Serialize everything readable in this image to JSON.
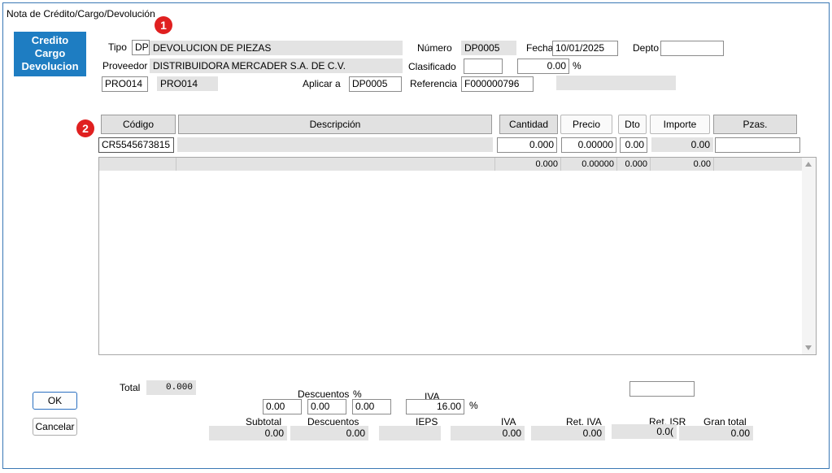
{
  "window": {
    "title": "Nota de Crédito/Cargo/Devolución"
  },
  "brand": {
    "line1": "Credito",
    "line2": "Cargo",
    "line3": "Devolucion"
  },
  "badges": {
    "one": "1",
    "two": "2"
  },
  "header": {
    "tipo_label": "Tipo",
    "tipo_code": "DP",
    "tipo_desc": "DEVOLUCION DE PIEZAS",
    "numero_label": "Número",
    "numero_value": "DP0005",
    "fecha_label": "Fecha",
    "fecha_value": "10/01/2025",
    "depto_label": "Depto",
    "depto_value": "",
    "proveedor_label": "Proveedor",
    "proveedor_value": "DISTRIBUIDORA MERCADER S.A. DE C.V.",
    "clasificado_label": "Clasificado",
    "clasificado_value": "",
    "pct_value": "0.00",
    "pct_symbol": "%",
    "prov_code_input": "PRO014",
    "prov_code_display": "PRO014",
    "aplicar_label": "Aplicar a",
    "aplicar_value": "DP0005",
    "referencia_label": "Referencia",
    "referencia_value": "F000000796",
    "extra_value": ""
  },
  "columns": {
    "codigo": "Código",
    "descripcion": "Descripción",
    "cantidad": "Cantidad",
    "precio": "Precio",
    "dto": "Dto",
    "importe": "Importe",
    "pzas": "Pzas."
  },
  "entry": {
    "codigo": "CR5545673815",
    "descripcion": "",
    "cantidad": "0.000",
    "precio": "0.00000",
    "dto": "0.00",
    "importe": "0.00",
    "pzas": ""
  },
  "grid_row": {
    "cantidad": "0.000",
    "precio": "0.00000",
    "dto": "0.000",
    "importe": "0.00"
  },
  "footer": {
    "total_label": "Total",
    "total_value": "0.000",
    "descuentos_label": "Descuentos",
    "descuentos_pct": "%",
    "desc1": "0.00",
    "desc2": "0.00",
    "desc3": "0.00",
    "iva_label": "IVA",
    "iva_value": "16.00",
    "iva_pct": "%",
    "right_box": "",
    "ok": "OK",
    "cancelar": "Cancelar",
    "subtotal_label": "Subtotal",
    "subtotal_value": "0.00",
    "descuentos2_label": "Descuentos",
    "descuentos2_value": "0.00",
    "ieps_label": "IEPS",
    "ieps_value": "",
    "iva2_label": "IVA",
    "iva2_value": "0.00",
    "retiva_label": "Ret. IVA",
    "retiva_value": "0.00",
    "retisr_label": "Ret. ISR",
    "retisr_value": "0.0(",
    "grantotal_label": "Gran total",
    "grantotal_value": "0.00"
  }
}
